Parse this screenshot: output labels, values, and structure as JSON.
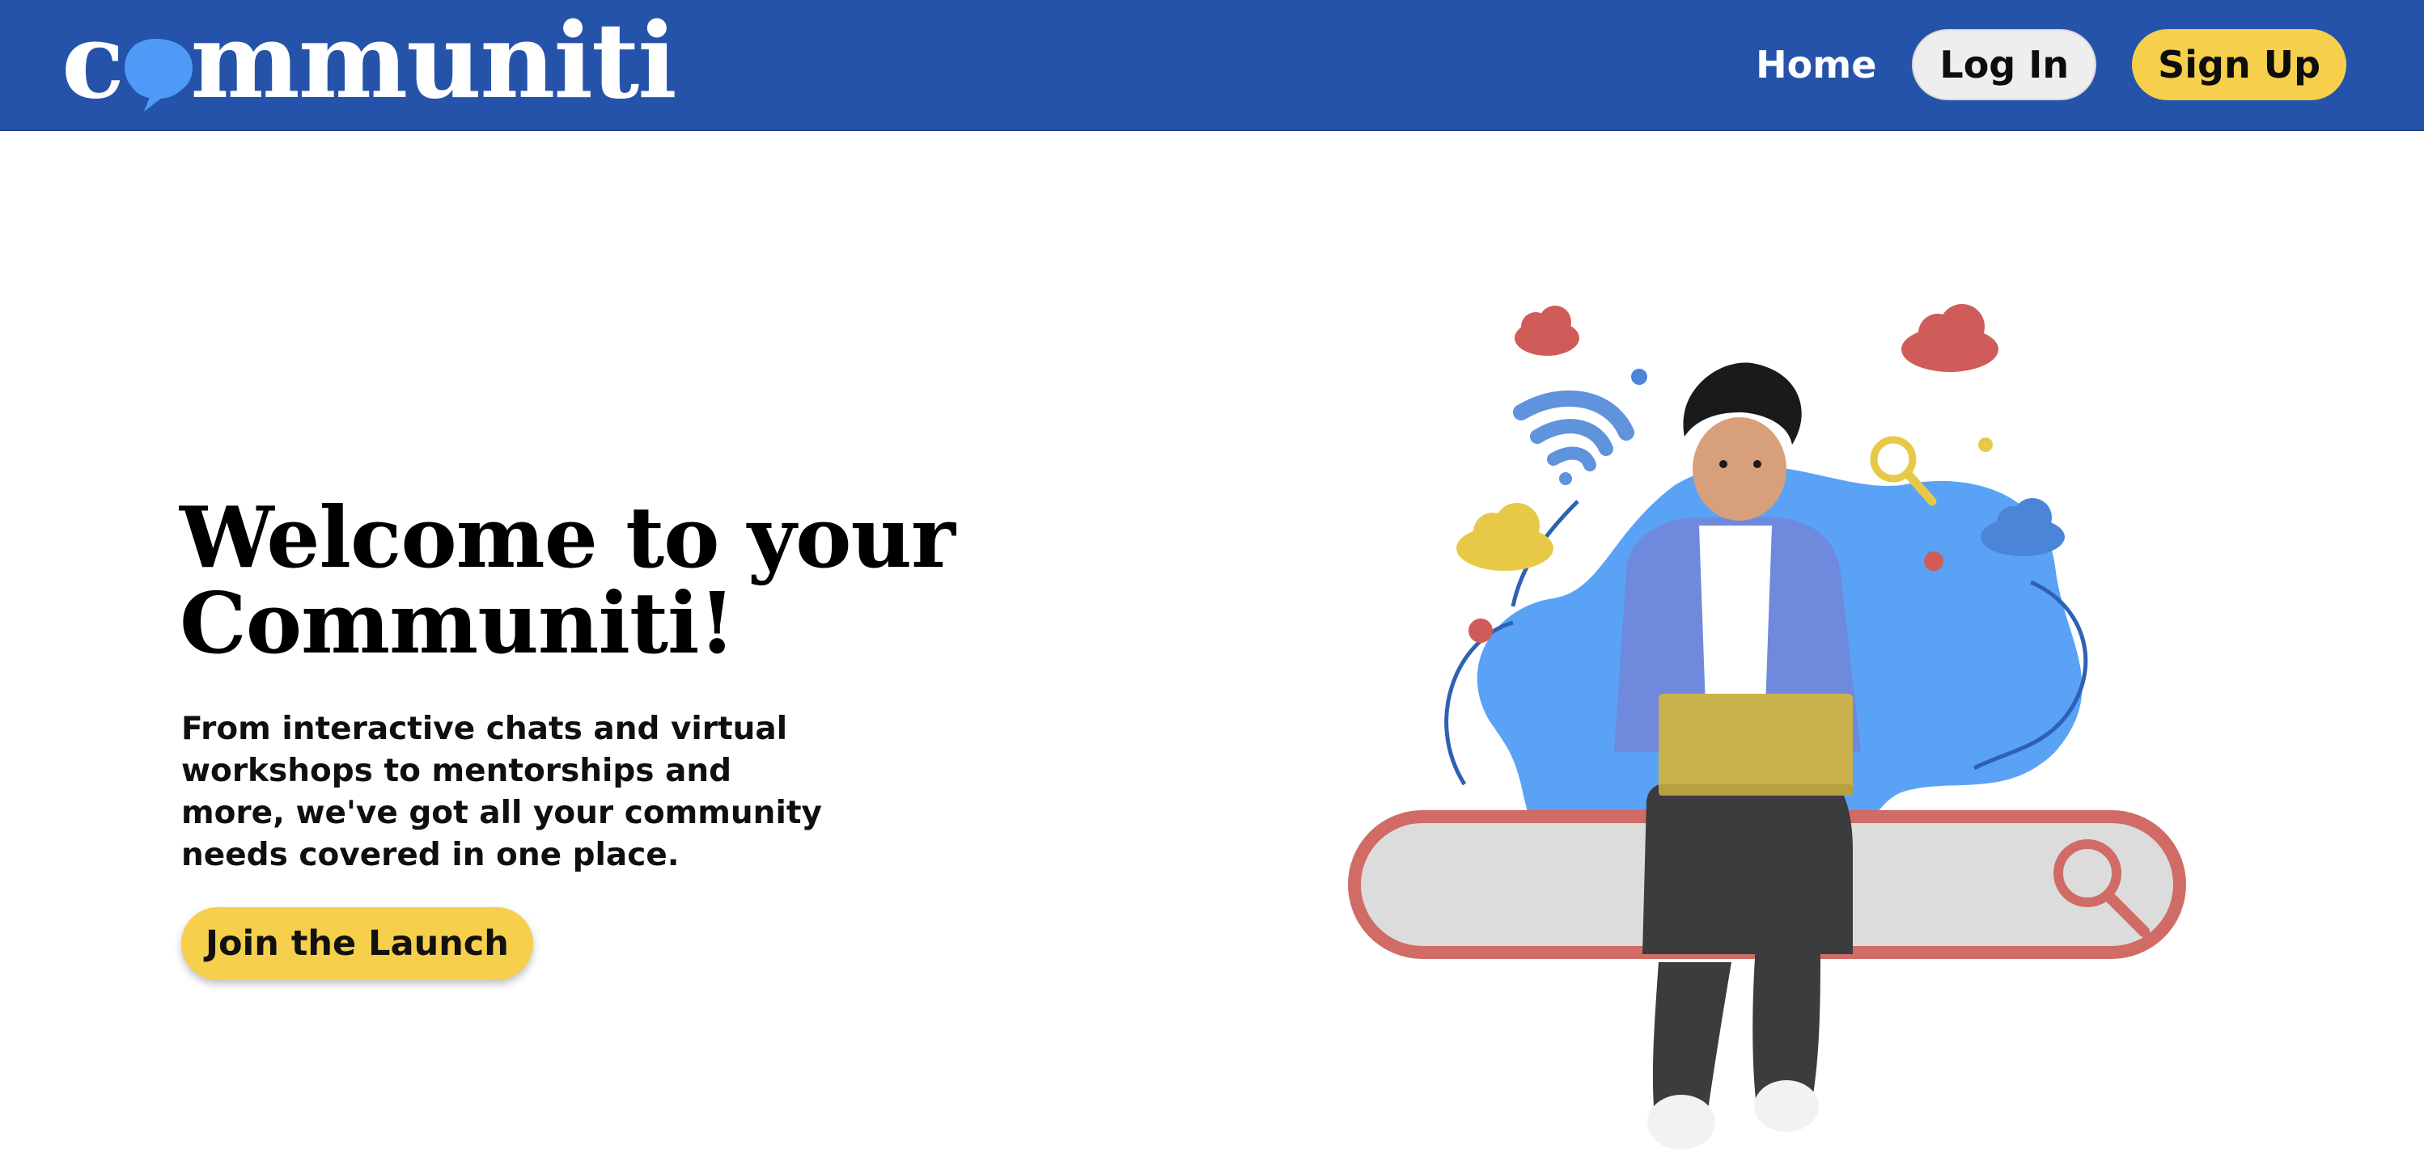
{
  "brand": {
    "logo_c": "c",
    "logo_o": "o",
    "logo_rest": "mmuniti"
  },
  "nav": {
    "home": "Home",
    "login": "Log In",
    "signup": "Sign Up"
  },
  "hero": {
    "title": "Welcome to your Communiti!",
    "description": "From interactive chats and virtual workshops to mentorships and more, we've got all your community needs covered in one place.",
    "cta": "Join the Launch"
  },
  "colors": {
    "header": "#2553a9",
    "accent_yellow": "#f6cf4c",
    "accent_blue": "#4f9af6"
  }
}
